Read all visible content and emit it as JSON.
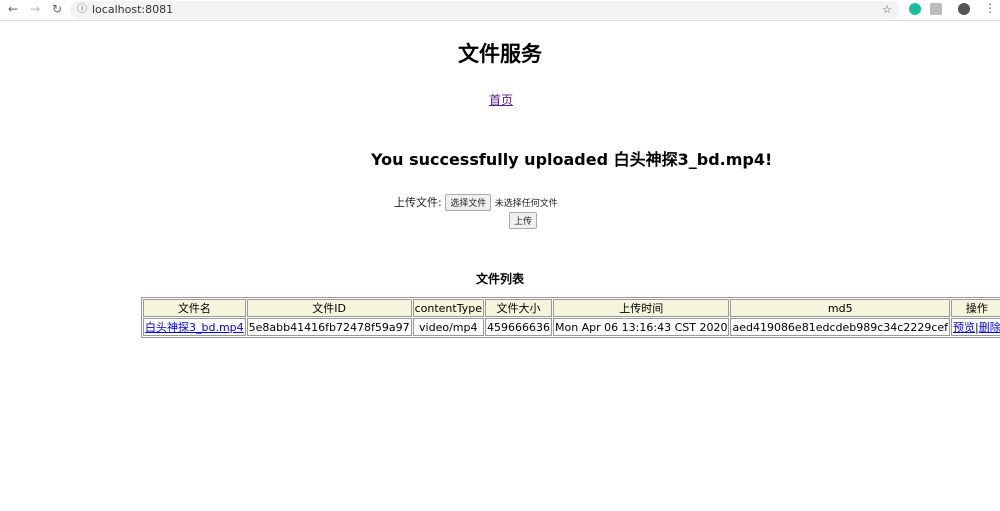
{
  "browser": {
    "url": "localhost:8081"
  },
  "page": {
    "title": "文件服务",
    "home_link": "首页",
    "message": "You successfully uploaded 白头神探3_bd.mp4!"
  },
  "upload": {
    "label": "上传文件:",
    "choose_button": "选择文件",
    "no_file": "未选择任何文件",
    "submit": "上传"
  },
  "list": {
    "title": "文件列表",
    "headers": [
      "文件名",
      "文件ID",
      "contentType",
      "文件大小",
      "上传时间",
      "md5",
      "操作"
    ],
    "rows": [
      {
        "name": "白头神探3_bd.mp4",
        "id": "5e8abb41416fb72478f59a97",
        "type": "video/mp4",
        "size": "459666636",
        "time": "Mon Apr 06 13:16:43 CST 2020",
        "md5": "aed419086e81edcdeb989c34c2229cef",
        "preview": "预览",
        "delete": "删除"
      }
    ]
  }
}
